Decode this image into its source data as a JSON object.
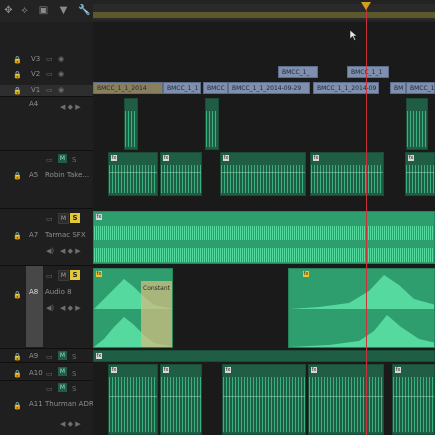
{
  "tracks": {
    "v3": "V3",
    "v2": "V2",
    "v1": "V1",
    "a4": "A4",
    "a5": "A5",
    "a5_name": "Robin Take...",
    "a7": "A7",
    "a7_name": "Tarmac SFX",
    "a8": "A8",
    "a8_name": "Audio 8",
    "a9": "A9",
    "a10": "A10",
    "a11": "A11",
    "a11_name": "Thurman ADR"
  },
  "buttons": {
    "m": "M",
    "s": "S"
  },
  "clips": {
    "v2_a": "BMCC_1_",
    "v2_b": "BMCC_1_1",
    "v1_a": "BMCC_1_1_2014",
    "v1_b": "BMCC_1_1",
    "v1_c": "BMCC",
    "v1_d": "BMCC_1_1_2014-09-29",
    "v1_e": "BMCC_1_1_2014-09",
    "v1_f": "BM",
    "v1_g": "BMCC_1_1",
    "transition": "Constant"
  },
  "colors": {
    "video_clip": "#7f8fae",
    "audio_clip": "#1f5e45",
    "waveform": "#3fbf88",
    "solo": "#e3c83a",
    "playhead": "#c8323a"
  },
  "icons": [
    "magnet-icon",
    "razor-icon",
    "marker-icon",
    "wrench-icon",
    "lock-icon",
    "eye-icon",
    "speaker-icon",
    "mic-icon"
  ]
}
